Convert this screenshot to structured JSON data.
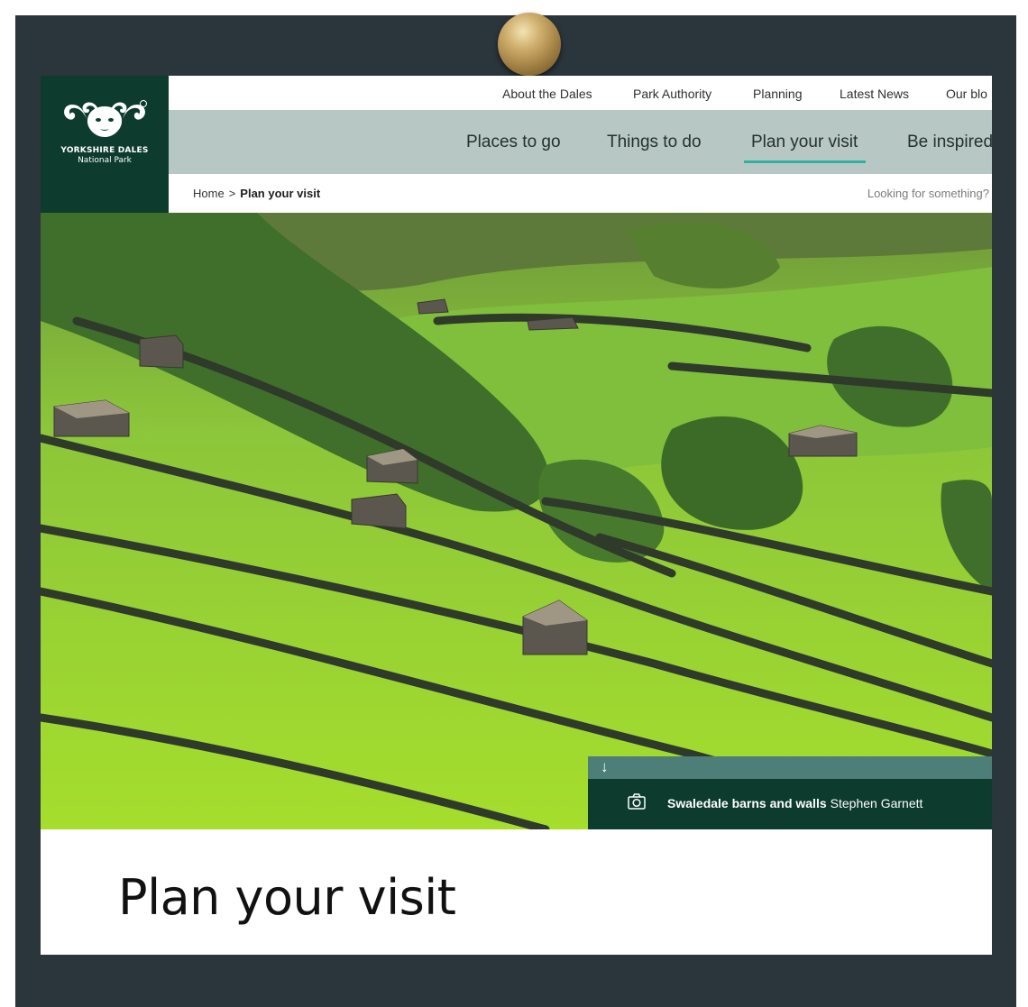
{
  "logo": {
    "title": "YORKSHIRE DALES",
    "subtitle": "National Park",
    "icon": "ram-heads-logo"
  },
  "top_nav": {
    "items": [
      "About the Dales",
      "Park Authority",
      "Planning",
      "Latest News",
      "Our blo"
    ]
  },
  "main_nav": {
    "items": [
      "Places to go",
      "Things to do",
      "Plan your visit",
      "Be inspired"
    ],
    "active": "Plan your visit"
  },
  "breadcrumb": {
    "home": "Home",
    "separator": ">",
    "current": "Plan your visit"
  },
  "search": {
    "hint": "Looking for something?"
  },
  "hero": {
    "scroll_icon": "down-arrow-icon",
    "camera_icon": "camera-icon",
    "caption_title": "Swaledale barns and walls",
    "caption_credit": "Stephen Garnett"
  },
  "page": {
    "title": "Plan your visit"
  },
  "colors": {
    "brand_dark_green": "#0d3b2d",
    "nav_sage": "#b7c8c4",
    "active_underline": "#2fb3a0",
    "caption_tab": "#4e7e78",
    "frame": "#2b353c"
  }
}
